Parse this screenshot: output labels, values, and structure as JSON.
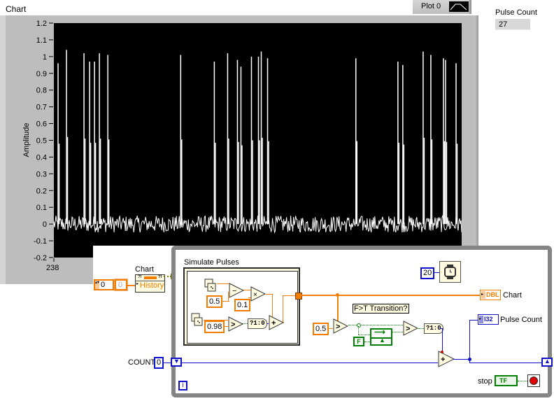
{
  "front_panel": {
    "chart_label": "Chart",
    "legend": {
      "plot_name": "Plot 0"
    },
    "pulse_count": {
      "label": "Pulse Count",
      "value": "27"
    }
  },
  "chart_data": {
    "type": "line",
    "title": "Chart",
    "xlabel": "",
    "ylabel": "Amplitude",
    "ylim": [
      -0.2,
      1.2
    ],
    "yticks": [
      "1.2",
      "1.1",
      "1",
      "0.9",
      "0.8",
      "0.7",
      "0.6",
      "0.5",
      "0.4",
      "0.3",
      "0.2",
      "0.1",
      "0",
      "-0.1",
      "-0.2"
    ],
    "ytick_values": [
      1.2,
      1.1,
      1,
      0.9,
      0.8,
      0.7,
      0.6,
      0.5,
      0.4,
      0.3,
      0.2,
      0.1,
      0,
      -0.1,
      -0.2
    ],
    "xticks": [
      "238"
    ],
    "x_start": 238,
    "num_points": 583,
    "noise_amplitude": 0.025,
    "series": [
      {
        "name": "Plot 0",
        "color": "#ffffff",
        "pulse_indices": [
          6,
          18,
          43,
          51,
          58,
          65,
          77,
          181,
          229,
          248,
          262,
          267,
          282,
          292,
          296,
          305,
          431,
          491,
          498,
          527,
          538,
          559,
          556,
          574
        ],
        "pulse_heights": [
          0.96,
          1.04,
          1.02,
          0.97,
          0.97,
          1.02,
          1.01,
          1.01,
          0.97,
          1.02,
          0.98,
          0.94,
          1.0,
          1.0,
          1.03,
          0.99,
          0.99,
          0.97,
          0.95,
          1.03,
          1.01,
          0.98,
          0.99,
          0.96
        ]
      }
    ]
  },
  "block_diagram": {
    "chart_terminal_label": "Chart",
    "history_label": "History",
    "history_index_value": "0",
    "history_const_value": "0",
    "simulate_pulses_label": "Simulate Pulses",
    "const_05_a": "0.5",
    "const_01": "0.1",
    "const_098": "0.98",
    "subtract_op": "−",
    "multiply_op": "×",
    "greater_op": ">",
    "add_op": "+",
    "bool_to_int": "?1:0",
    "wait_ms": "20",
    "chart_indicator_type": "DBL",
    "chart_indicator_label": "Chart",
    "transition_label": "F>T Transition?",
    "const_05_b": "0.5",
    "false_const": "F",
    "pulse_count_type": "I32",
    "pulse_count_label": "Pulse Count",
    "count_label": "COUNT",
    "count_init": "0",
    "iteration_label": "i",
    "stop_label": "stop",
    "stop_type": "TF"
  }
}
